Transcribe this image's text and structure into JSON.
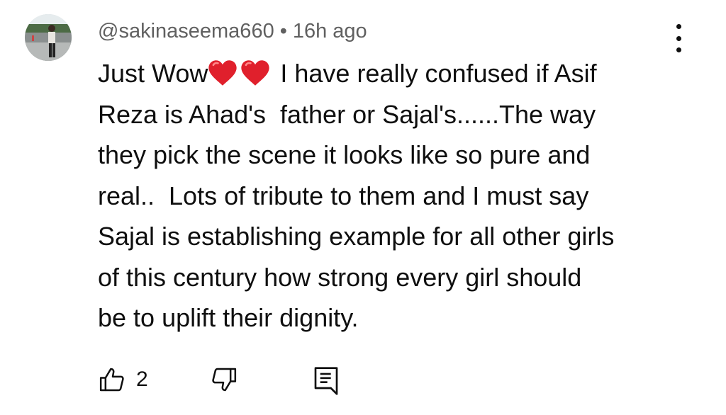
{
  "comment": {
    "author": "@sakinaseema660",
    "separator": "•",
    "time": "16h ago",
    "lines": [
      {
        "before": "Just Wow",
        "emoji": "❤️❤️",
        "after": " I have really confused if Asif"
      },
      {
        "text": "Reza is Ahad's  father or Sajal's......The way"
      },
      {
        "text": "they pick the scene it looks like so pure and"
      },
      {
        "text": "real..  Lots of tribute to them and I must say"
      },
      {
        "text": "Sajal is establishing example for all other girls"
      },
      {
        "text": "of this century how strong every girl should"
      },
      {
        "text": "be to uplift their dignity."
      }
    ],
    "like_count": "2"
  },
  "icons": {
    "menu": "more-vert-icon",
    "like": "thumb-up-icon",
    "dislike": "thumb-down-icon",
    "reply": "reply-comment-icon",
    "heart": "red-heart-emoji"
  },
  "colors": {
    "text": "#0f0f0f",
    "meta": "#606060",
    "heart": "#e0202c"
  }
}
